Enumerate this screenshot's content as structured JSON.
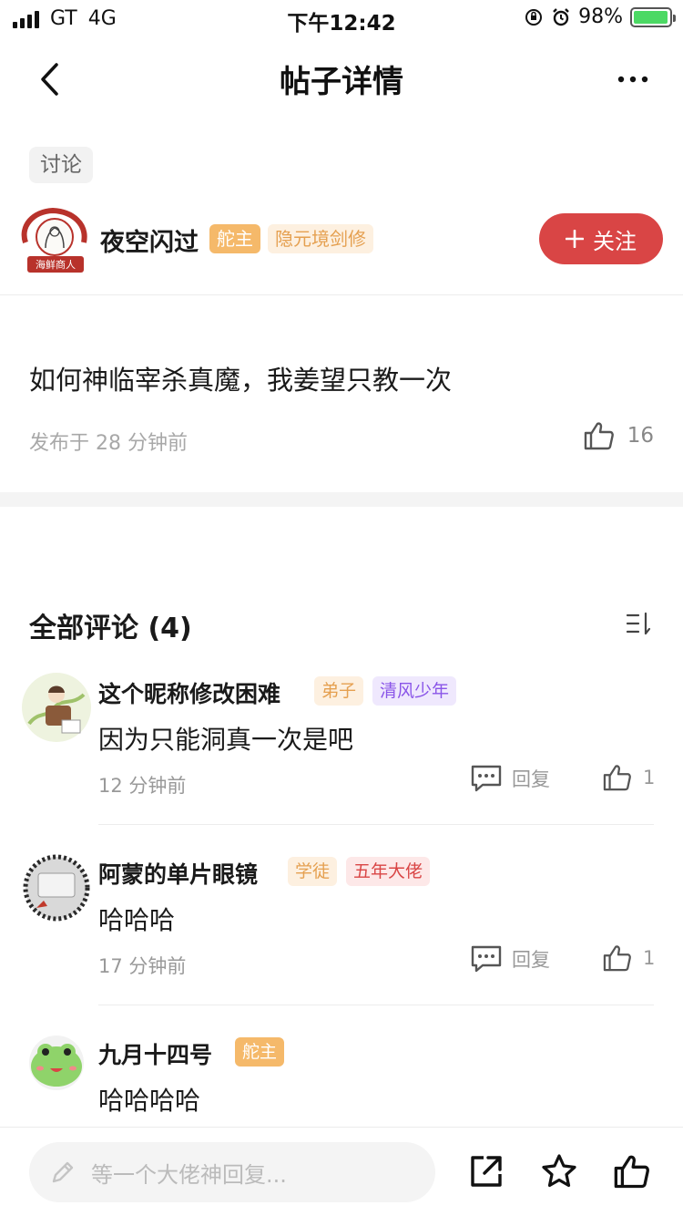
{
  "status_bar": {
    "carrier": "GT",
    "network": "4G",
    "time": "下午12:42",
    "battery": "98%"
  },
  "nav": {
    "title": "帖子详情"
  },
  "post": {
    "category": "讨论",
    "author": {
      "name": "夜空闪过",
      "role_badge": "舵主",
      "level_badge": "隐元境剑修",
      "avatar_caption": "海鲜商人"
    },
    "follow_label": "关注",
    "body": "如何神临宰杀真魔，我姜望只教一次",
    "published": "发布于 28 分钟前",
    "likes": "16"
  },
  "comments_section": {
    "title": "全部评论 (4)",
    "reply_label": "回复",
    "items": [
      {
        "name": "这个昵称修改困难",
        "badges": [
          {
            "text": "弟子",
            "bg": "#fdf0e0",
            "fg": "#e5a050"
          },
          {
            "text": "清风少年",
            "bg": "#efe8fd",
            "fg": "#8a55e8"
          }
        ],
        "text": "因为只能洞真一次是吧",
        "time": "12 分钟前",
        "likes": "1"
      },
      {
        "name": "阿蒙的单片眼镜",
        "badges": [
          {
            "text": "学徒",
            "bg": "#fdf0e0",
            "fg": "#e5a050"
          },
          {
            "text": "五年大佬",
            "bg": "#fde8e8",
            "fg": "#d94545"
          }
        ],
        "text": "哈哈哈",
        "time": "17 分钟前",
        "likes": "1"
      },
      {
        "name": "九月十四号",
        "badges": [
          {
            "text": "舵主",
            "bg": "#f5b96a",
            "fg": "#ffffff"
          }
        ],
        "text": "哈哈哈哈",
        "time": "",
        "likes": ""
      }
    ]
  },
  "bottom_bar": {
    "placeholder": "等一个大佬神回复..."
  },
  "colors": {
    "accent_red": "#d94545",
    "badge_orange": "#f5b96a"
  },
  "icons": [
    "back-icon",
    "more-icon",
    "plus-icon",
    "thumb-up-icon",
    "sort-icon",
    "reply-icon",
    "pencil-icon",
    "share-icon",
    "star-icon"
  ]
}
